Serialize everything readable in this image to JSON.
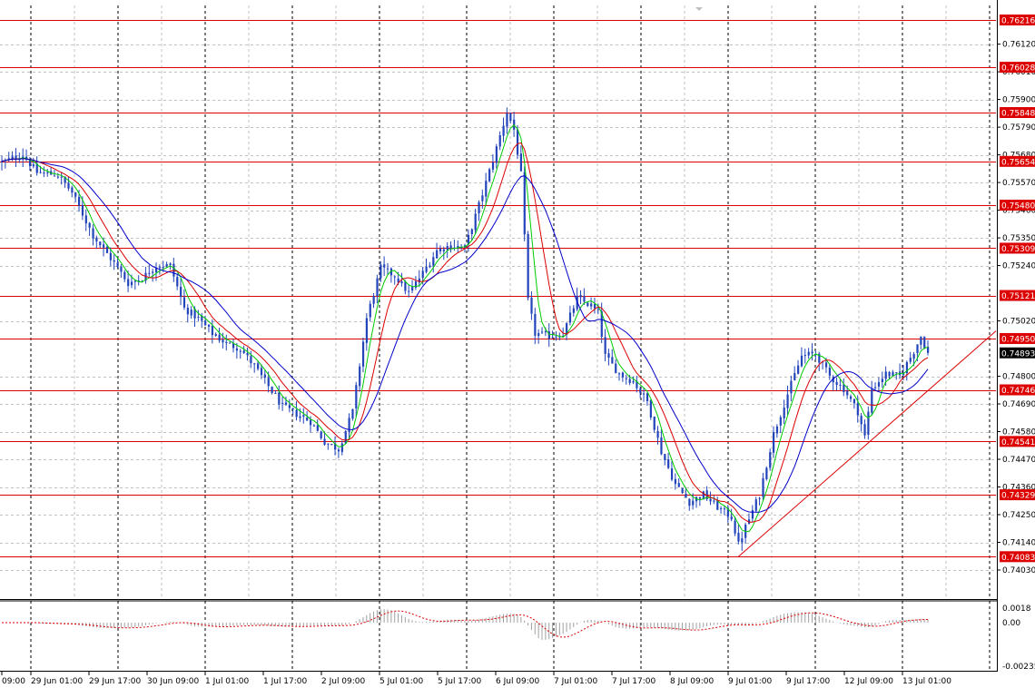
{
  "chart_data": {
    "type": "candlestick",
    "symbol_colors": {
      "candle": "#2244bb",
      "ma_fast": "#00cc00",
      "ma_mid": "#dd0000",
      "ma_slow": "#0000cc",
      "level_line": "#dd0000",
      "trendline": "#dd0000",
      "osc_line": "#dd0000",
      "osc_hist": "#a0a0a0",
      "grid": "#c0c0c0",
      "current_price_bg": "#000000"
    },
    "ylim": [
      0.403,
      0.76216
    ],
    "price_axis": {
      "ylim": [
        0.7403,
        0.76216
      ],
      "tick_labels": [
        "0.76120",
        "0.76010",
        "0.75900",
        "0.75790",
        "0.75680",
        "0.75570",
        "0.75460",
        "0.75350",
        "0.75240",
        "0.75020",
        "0.74800",
        "0.74690",
        "0.74580",
        "0.74470",
        "0.74360",
        "0.74250",
        "0.74140",
        "0.74030"
      ]
    },
    "levels": [
      "0.76216",
      "0.76028",
      "0.75848",
      "0.75654",
      "0.75480",
      "0.75309",
      "0.75121",
      "0.74950",
      "0.74746",
      "0.74541",
      "0.74329",
      "0.74083"
    ],
    "current_price": "0.74893",
    "time_axis": {
      "tick_labels": [
        "09:00",
        "29 Jun 01:00",
        "29 Jun 17:00",
        "30 Jun 09:00",
        "1 Jul 01:00",
        "1 Jul 17:00",
        "2 Jul 09:00",
        "5 Jul 01:00",
        "5 Jul 17:00",
        "6 Jul 09:00",
        "7 Jul 01:00",
        "7 Jul 17:00",
        "8 Jul 09:00",
        "9 Jul 01:00",
        "9 Jul 17:00",
        "12 Jul 09:00",
        "13 Jul 01:00"
      ]
    },
    "oscillator": {
      "ylim": [
        -0.0015,
        0.0018
      ],
      "tick_labels": [
        "0.0018",
        "0.00",
        "-0.00235"
      ]
    },
    "close_path": [
      [
        0,
        0.7565
      ],
      [
        6,
        0.7568
      ],
      [
        10,
        0.7561
      ],
      [
        16,
        0.756
      ],
      [
        20,
        0.7553
      ],
      [
        26,
        0.7536
      ],
      [
        32,
        0.7525
      ],
      [
        36,
        0.7517
      ],
      [
        40,
        0.7519
      ],
      [
        44,
        0.7524
      ],
      [
        48,
        0.7524
      ],
      [
        52,
        0.7507
      ],
      [
        56,
        0.7503
      ],
      [
        60,
        0.7497
      ],
      [
        64,
        0.7493
      ],
      [
        68,
        0.7491
      ],
      [
        72,
        0.7484
      ],
      [
        76,
        0.7476
      ],
      [
        80,
        0.7468
      ],
      [
        84,
        0.7465
      ],
      [
        88,
        0.7462
      ],
      [
        92,
        0.7454
      ],
      [
        96,
        0.7451
      ],
      [
        100,
        0.7466
      ],
      [
        104,
        0.7503
      ],
      [
        108,
        0.7523
      ],
      [
        112,
        0.752
      ],
      [
        116,
        0.7513
      ],
      [
        120,
        0.7521
      ],
      [
        124,
        0.753
      ],
      [
        128,
        0.7532
      ],
      [
        132,
        0.7531
      ],
      [
        136,
        0.7548
      ],
      [
        140,
        0.7566
      ],
      [
        144,
        0.7585
      ],
      [
        146,
        0.7578
      ],
      [
        148,
        0.756
      ],
      [
        150,
        0.751
      ],
      [
        152,
        0.7497
      ],
      [
        156,
        0.7496
      ],
      [
        160,
        0.7497
      ],
      [
        164,
        0.7511
      ],
      [
        168,
        0.7508
      ],
      [
        170,
        0.7505
      ],
      [
        172,
        0.7488
      ],
      [
        176,
        0.7481
      ],
      [
        180,
        0.7478
      ],
      [
        184,
        0.747
      ],
      [
        188,
        0.745
      ],
      [
        192,
        0.7437
      ],
      [
        196,
        0.743
      ],
      [
        200,
        0.7433
      ],
      [
        204,
        0.7428
      ],
      [
        208,
        0.7424
      ],
      [
        210,
        0.7413
      ],
      [
        212,
        0.742
      ],
      [
        216,
        0.7433
      ],
      [
        220,
        0.7457
      ],
      [
        224,
        0.7473
      ],
      [
        228,
        0.7488
      ],
      [
        232,
        0.7489
      ],
      [
        236,
        0.748
      ],
      [
        240,
        0.7475
      ],
      [
        244,
        0.7466
      ],
      [
        246,
        0.7456
      ],
      [
        248,
        0.7475
      ],
      [
        252,
        0.7481
      ],
      [
        256,
        0.748
      ],
      [
        260,
        0.749
      ],
      [
        262,
        0.7496
      ],
      [
        264,
        0.7489
      ]
    ]
  }
}
